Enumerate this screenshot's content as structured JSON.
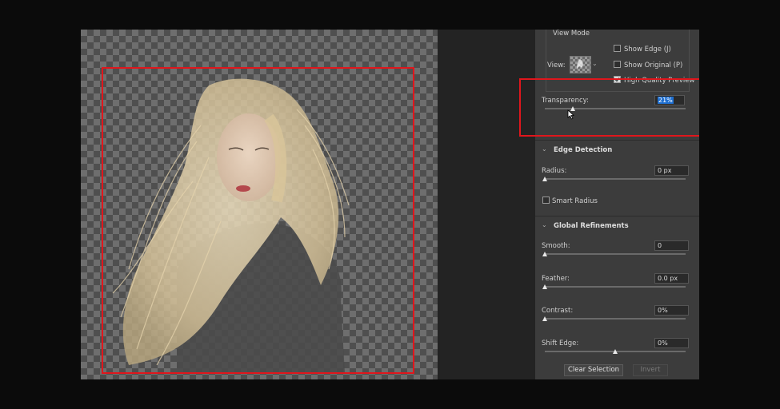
{
  "view_mode": {
    "title": "View Mode",
    "view_label": "View:",
    "show_edge": {
      "label": "Show Edge (J)",
      "checked": false
    },
    "show_original": {
      "label": "Show Original (P)",
      "checked": false
    },
    "high_quality": {
      "label": "High Quality Preview",
      "checked": true
    }
  },
  "transparency": {
    "label": "Transparency:",
    "value": "21%",
    "level": 0.21
  },
  "edge_detection": {
    "title": "Edge Detection",
    "radius": {
      "label": "Radius:",
      "value": "0 px"
    },
    "smart_radius": {
      "label": "Smart Radius",
      "checked": false
    }
  },
  "global_refinements": {
    "title": "Global Refinements",
    "smooth": {
      "label": "Smooth:",
      "value": "0"
    },
    "feather": {
      "label": "Feather:",
      "value": "0.0 px"
    },
    "contrast": {
      "label": "Contrast:",
      "value": "0%"
    },
    "shift_edge": {
      "label": "Shift Edge:",
      "value": "0%"
    }
  },
  "buttons": {
    "clear_selection": "Clear Selection",
    "invert": "Invert"
  },
  "colors": {
    "highlight": "#e0161c",
    "panel": "#3c3c3c",
    "selected_value": "#1f6fd0"
  },
  "icons": {
    "view_thumbnail": "view-mode-thumbnail-icon",
    "cursor": "mouse-pointer-icon"
  }
}
